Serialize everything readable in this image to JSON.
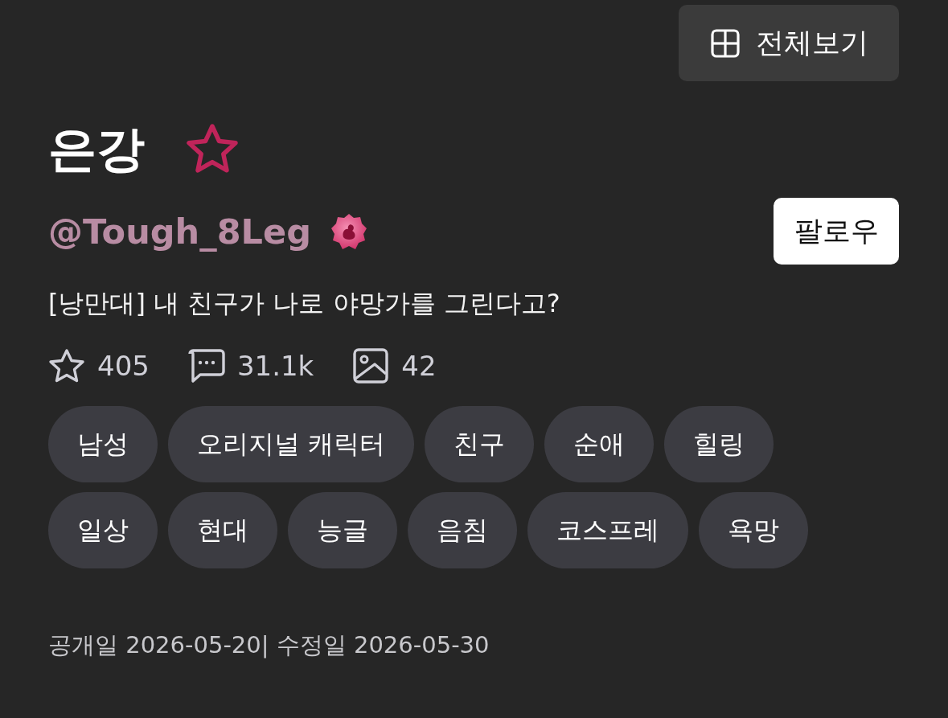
{
  "header": {
    "view_all_button": {
      "label": "전체보기"
    }
  },
  "title": {
    "text": "은강",
    "favorited": false
  },
  "author": {
    "handle": "@Tough_8Leg",
    "follow_label": "팔로우"
  },
  "description": "[낭만대] 내 친구가 나로 야망가를 그린다고?",
  "stats": [
    {
      "kind": "likes",
      "value": "405"
    },
    {
      "kind": "comments",
      "value": "31.1k"
    },
    {
      "kind": "images",
      "value": "42"
    }
  ],
  "tags": [
    "남성",
    "오리지널 캐릭터",
    "친구",
    "순애",
    "힐링",
    "일상",
    "현대",
    "능글",
    "음침",
    "코스프레",
    "욕망"
  ],
  "dates": "공개일 2026-05-20| 수정일 2026-05-30"
}
